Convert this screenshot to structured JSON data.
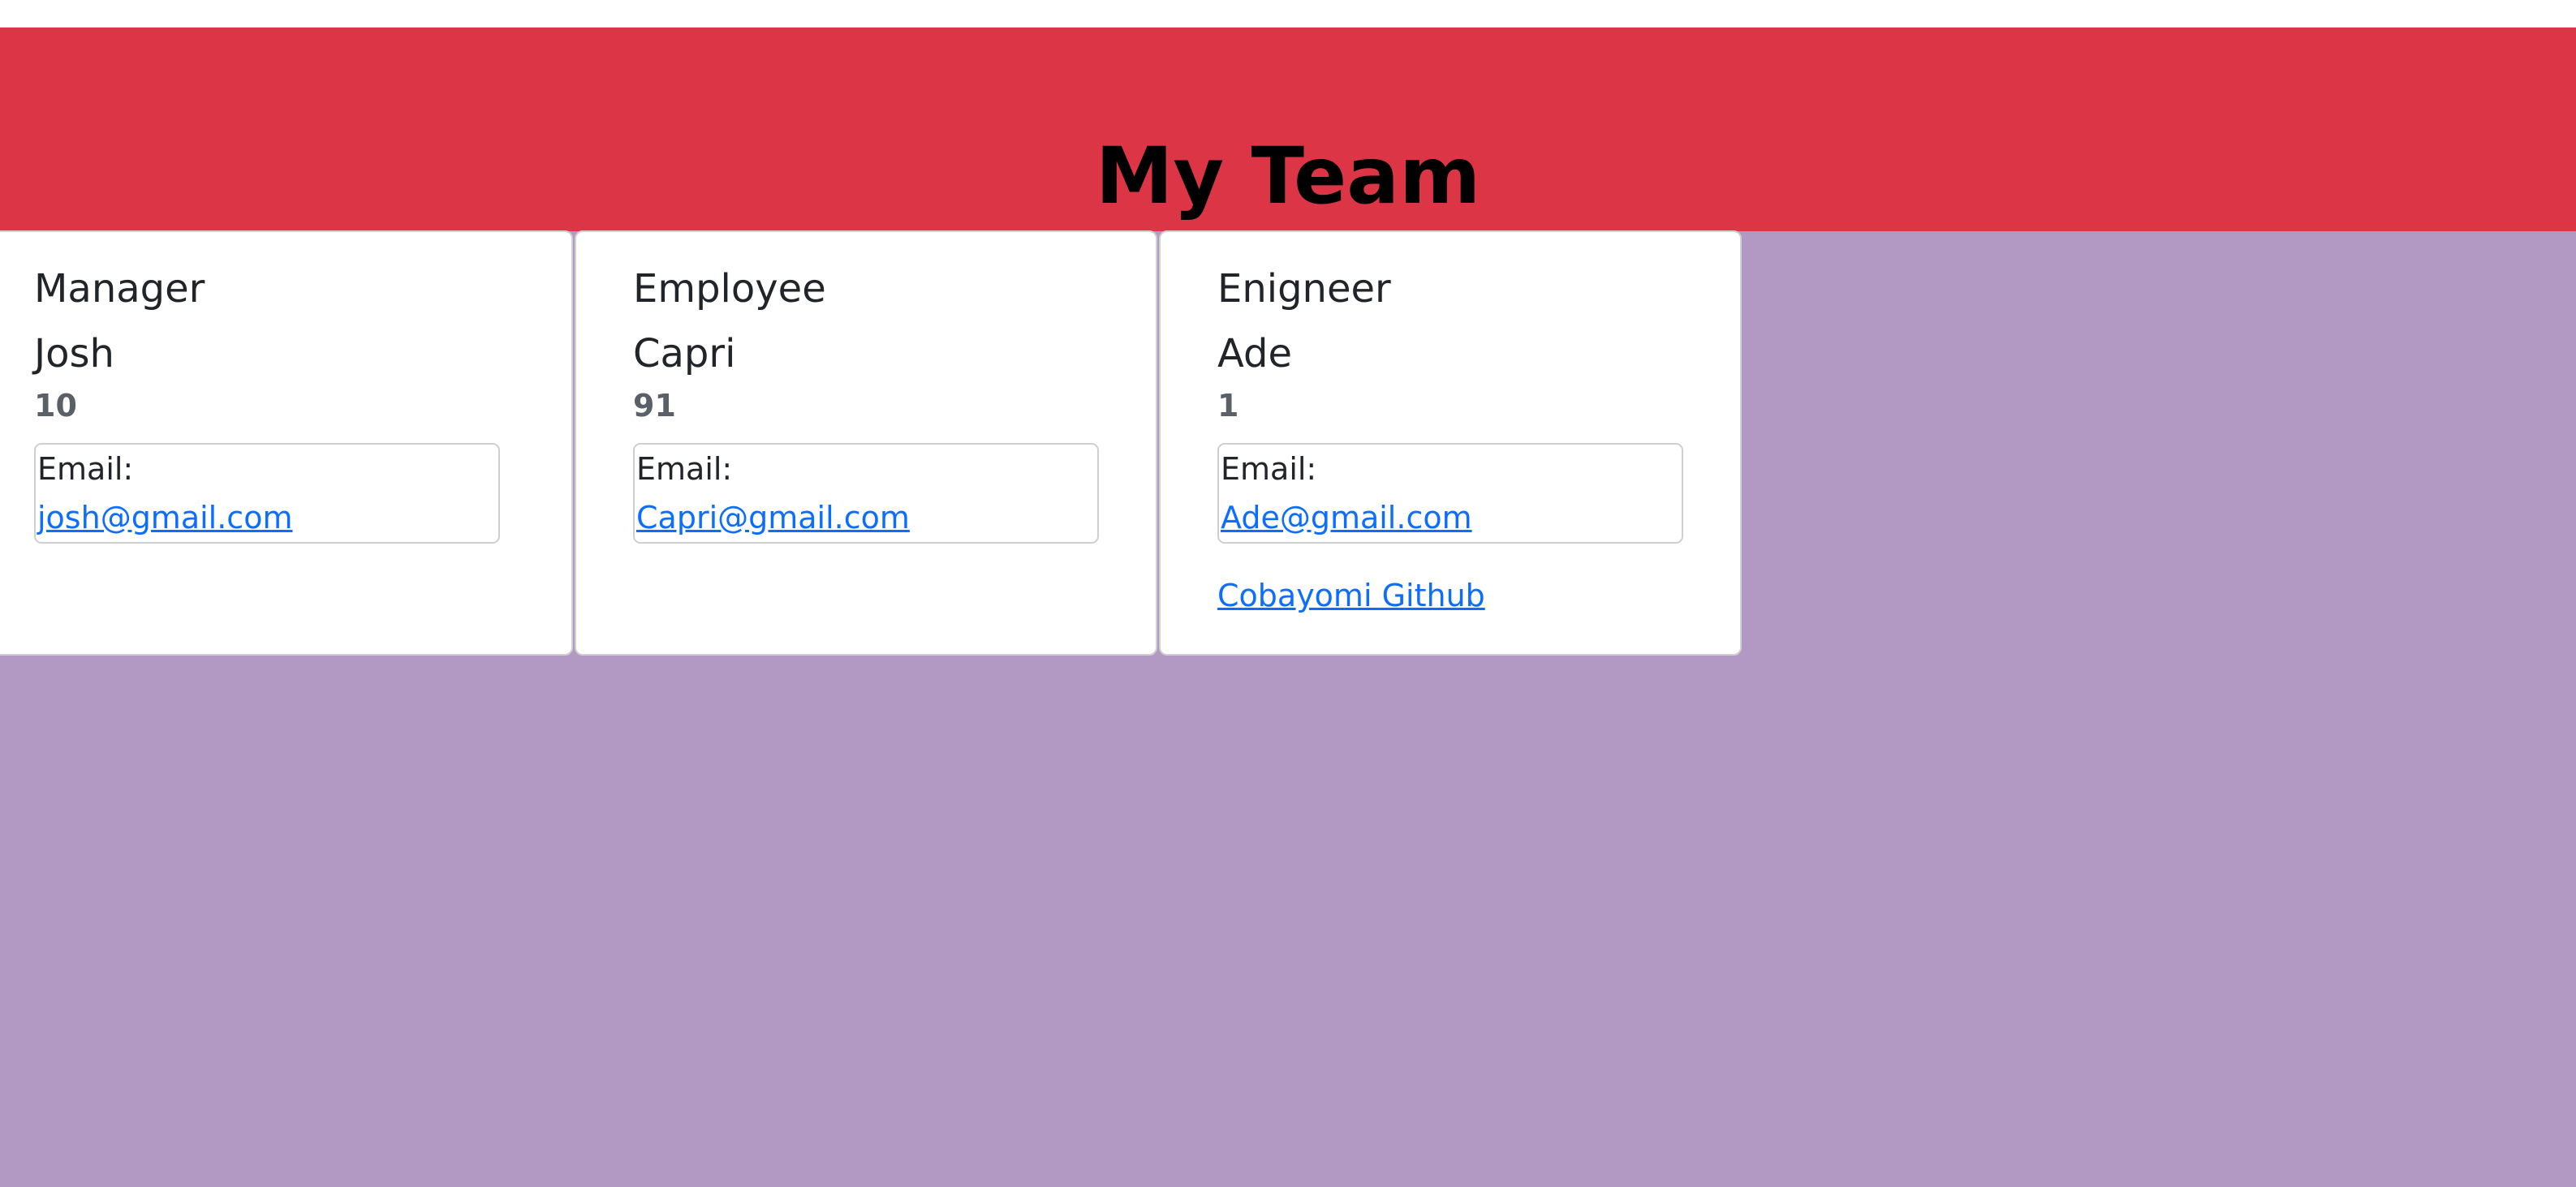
{
  "header": {
    "title": "My Team"
  },
  "cards": [
    {
      "role": "Manager",
      "name": "Josh",
      "id": "10",
      "email_label": "Email:",
      "email": "josh@gmail.com"
    },
    {
      "role": "Employee",
      "name": "Capri",
      "id": "91",
      "email_label": "Email:",
      "email": "Capri@gmail.com"
    },
    {
      "role": "Enigneer",
      "name": "Ade",
      "id": "1",
      "email_label": "Email:",
      "email": "Ade@gmail.com",
      "github": "Cobayomi Github"
    }
  ],
  "colors": {
    "banner": "#dc3545",
    "page_background": "#b199c3",
    "link": "#0d6efd"
  }
}
